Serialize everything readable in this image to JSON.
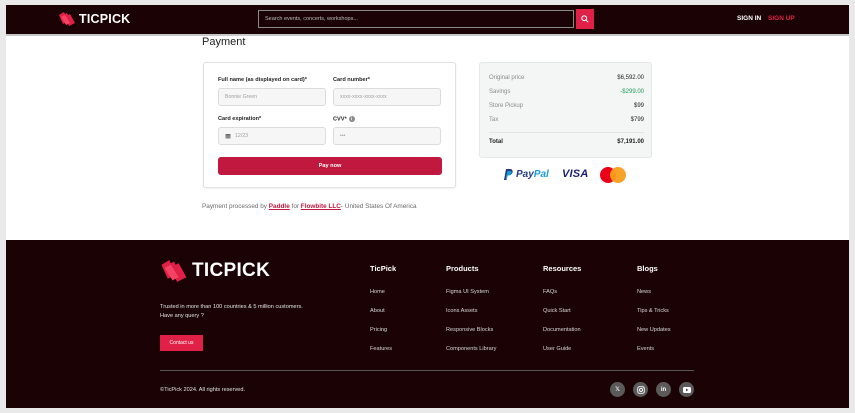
{
  "header": {
    "brand": "TICPICK",
    "search_placeholder": "Search events, concerts, workshops...",
    "sign_in": "SIGN IN",
    "sign_up": "SIGN UP"
  },
  "payment": {
    "title": "Payment",
    "full_name_label": "Full name (as displayed on card)*",
    "full_name_placeholder": "Bonnie Green",
    "card_number_label": "Card number*",
    "card_number_placeholder": "xxxx-xxxx-xxxx-xxxx",
    "expiration_label": "Card expiration*",
    "expiration_placeholder": "12/23",
    "cvv_label": "CVV*",
    "cvv_placeholder": "•••",
    "pay_button": "Pay now"
  },
  "summary": {
    "rows": [
      {
        "label": "Original price",
        "value": "$6,592.00"
      },
      {
        "label": "Savings",
        "value": "-$299.00"
      },
      {
        "label": "Store Pickup",
        "value": "$99"
      },
      {
        "label": "Tax",
        "value": "$799"
      }
    ],
    "total_label": "Total",
    "total_value": "$7,191.00"
  },
  "payment_logos": {
    "paypal_a": "Pay",
    "paypal_b": "Pal",
    "visa": "VISA"
  },
  "processed": {
    "prefix": "Payment processed by",
    "paddle": "Paddle",
    "for": "for",
    "company": "Flowbite LLC",
    "suffix": "- United States Of America"
  },
  "footer": {
    "brand": "TICPICK",
    "tagline": "Trusted in more than 100 countries & 5 million customers. Have any query ?",
    "contact_button": "Contact us",
    "columns": [
      {
        "title": "TicPick",
        "links": [
          "Home",
          "About",
          "Pricing",
          "Features"
        ]
      },
      {
        "title": "Products",
        "links": [
          "Figma UI System",
          "Icons Assets",
          "Responsive Blocks",
          "Components Library"
        ]
      },
      {
        "title": "Resources",
        "links": [
          "FAQs",
          "Quick Start",
          "Documentation",
          "User Guide"
        ]
      },
      {
        "title": "Blogs",
        "links": [
          "News",
          "Tips & Tricks",
          "New Updates",
          "Events"
        ]
      }
    ],
    "copyright": "©TicPick 2024. All rights reserved.",
    "social": [
      "x-icon",
      "instagram-icon",
      "linkedin-icon",
      "youtube-icon"
    ]
  },
  "colors": {
    "brand_red": "#e02047",
    "button_red": "#c0183f",
    "dark_bg": "#1b0305",
    "savings_green": "#1f9d55"
  }
}
